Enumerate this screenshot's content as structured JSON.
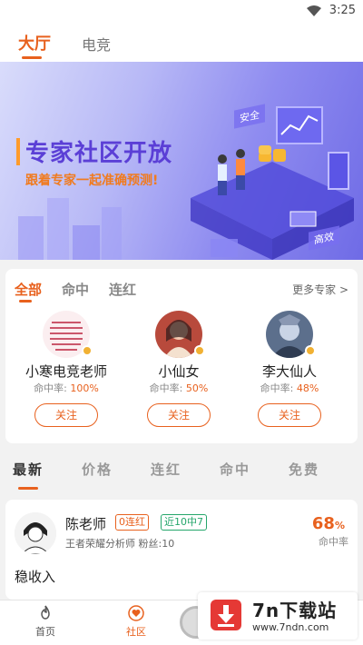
{
  "status": {
    "time": "3:25"
  },
  "topnav": {
    "tabs": [
      {
        "label": "大厅"
      },
      {
        "label": "电竞"
      }
    ]
  },
  "banner": {
    "title": "专家社区开放",
    "subtitle": "跟着专家一起准确预测!",
    "tag_safe": "安全",
    "tag_efficient": "高效"
  },
  "experts": {
    "tabs": [
      {
        "label": "全部"
      },
      {
        "label": "命中"
      },
      {
        "label": "连红"
      }
    ],
    "more": "更多专家 >",
    "rate_label": "命中率:",
    "follow_label": "关注",
    "cards": [
      {
        "name": "小寒电竞老师",
        "rate": "100%"
      },
      {
        "name": "小仙女",
        "rate": "50%"
      },
      {
        "name": "李大仙人",
        "rate": "48%"
      }
    ]
  },
  "sortbar": {
    "tabs": [
      {
        "label": "最新"
      },
      {
        "label": "价格"
      },
      {
        "label": "连红"
      },
      {
        "label": "命中"
      },
      {
        "label": "免费"
      }
    ]
  },
  "post": {
    "name": "陈老师",
    "badge_red": "0连红",
    "badge_green": "近10中7",
    "desc": "王者荣耀分析师  粉丝:10",
    "rate_value": "68",
    "rate_unit": "%",
    "rate_label": "命中率",
    "title": "稳收入"
  },
  "bottombar": {
    "items": [
      {
        "label": "首页"
      },
      {
        "label": "社区"
      }
    ]
  },
  "watermark": {
    "brand": "7n下载站",
    "url": "www.7ndn.com"
  },
  "colors": {
    "accent": "#e8611e",
    "green": "#25a66b"
  }
}
